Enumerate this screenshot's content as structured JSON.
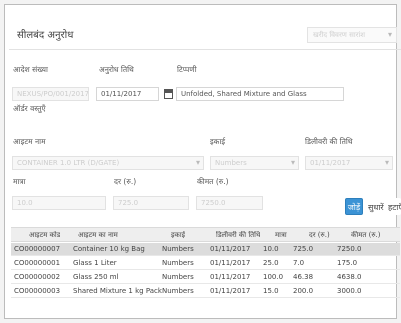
{
  "header": {
    "title": "सीलबंद अनुरोध",
    "select_value": "खरीद विवरण सारांश"
  },
  "order": {
    "order_no_label": "आदेश संख्या",
    "order_date_label": "अनुरोध तिथि",
    "order_date_value": "01/11/2017",
    "remark_label": "टिप्पणी",
    "remark_value": "Unfolded, Shared Mixture and Glass",
    "order_no_value": "NEXUS/PO/001/2017",
    "section_label": "ऑर्डर वस्तुएँ"
  },
  "item": {
    "item_label": "आइटम नाम",
    "unit_label": "इकाई",
    "delivery_date_label": "डिलीवरी की तिथि",
    "item_value": "CONTAINER 1.0 LTR (D/GATE)",
    "unit_value": "Numbers",
    "delivery_date_value": "01/11/2017",
    "qty_label": "मात्रा",
    "rate_label": "दर (रु.)",
    "amount_label": "कीमत (रु.)",
    "qty_value": "10.0",
    "rate_value": "725.0",
    "amount_value": "7250.0"
  },
  "buttons": {
    "add": "जोड़ें",
    "update": "सुधारें",
    "delete": "हटाएँ"
  },
  "table": {
    "headers": [
      "आइटम कोड",
      "आइटम का नाम",
      "इकाई",
      "डिलीवरी की तिथि",
      "मात्रा",
      "दर (रु.)",
      "कीमत (रु.)"
    ],
    "rows": [
      [
        "CO00000007",
        "Container 10 kg Bag",
        "Numbers",
        "01/11/2017",
        "10.0",
        "725.0",
        "7250.0"
      ],
      [
        "CO00000001",
        "Glass 1 Liter",
        "Numbers",
        "01/11/2017",
        "25.0",
        "7.0",
        "175.0"
      ],
      [
        "CO00000002",
        "Glass 250 ml",
        "Numbers",
        "01/11/2017",
        "100.0",
        "46.38",
        "4638.0"
      ],
      [
        "CO00000003",
        "Shared Mixture 1 kg Pack",
        "Numbers",
        "01/11/2017",
        "15.0",
        "200.0",
        "3000.0"
      ]
    ]
  }
}
